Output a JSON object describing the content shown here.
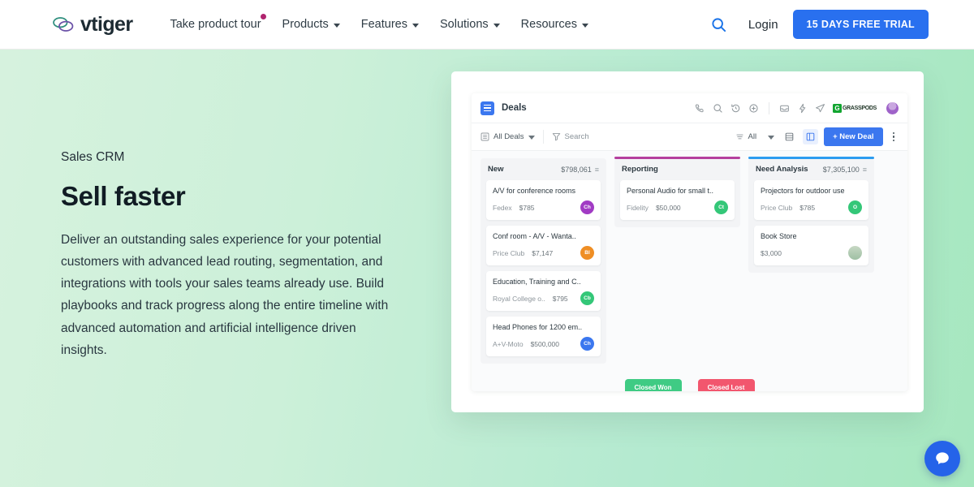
{
  "nav": {
    "logo_text": "vtiger",
    "logo_icon": "vtiger-cloud-logo",
    "links": [
      {
        "label": "Take product tour",
        "caret": false,
        "badge": true
      },
      {
        "label": "Products",
        "caret": true,
        "badge": false
      },
      {
        "label": "Features",
        "caret": true,
        "badge": false
      },
      {
        "label": "Solutions",
        "caret": true,
        "badge": false
      },
      {
        "label": "Resources",
        "caret": true,
        "badge": false
      }
    ],
    "search_icon": "search-icon",
    "login_label": "Login",
    "trial_label": "15 DAYS FREE TRIAL",
    "trial_color": "#2970ef"
  },
  "hero": {
    "eyebrow": "Sales CRM",
    "title": "Sell faster",
    "body": "Deliver an outstanding sales experience for your potential customers with advanced lead routing, segmentation, and integrations with tools your sales teams already use. Build playbooks and track progress along the entire timeline with advanced automation and artificial intelligence driven insights.",
    "bg_from": "#d6f2de",
    "bg_to": "#a6e7bf"
  },
  "app": {
    "topbar": {
      "menu_icon": "hamburger-square-icon",
      "title": "Deals",
      "icons": [
        "phone-icon",
        "search-icon",
        "history-icon",
        "plus-circle-icon",
        "inbox-icon",
        "lightning-icon",
        "paper-plane-icon"
      ],
      "brand_badge_letter": "G",
      "brand_badge_text": "GRASSPODS",
      "brand_badge_color": "#12a530",
      "avatar": "user-avatar"
    },
    "toolbar": {
      "view_label": "All Deals",
      "view_icon": "list-box-icon",
      "filter_icon": "funnel-icon",
      "search_placeholder": "Search",
      "sort_icon": "sort-lines-icon",
      "sort_label": "All",
      "list_view_icon": "list-view-icon",
      "board_view_icon": "kanban-view-icon",
      "new_deal_label": "+ New Deal",
      "new_deal_color": "#3b77ef",
      "more_icon": "kebab-menu-icon"
    },
    "columns": [
      {
        "name": "New",
        "total": "$798,061",
        "accent": "",
        "cards": [
          {
            "title": "A/V for conference rooms",
            "account": "Fedex",
            "amount": "$785",
            "avatar_text": "Ch",
            "avatar_color": "#a13bc4"
          },
          {
            "title": "Conf room - A/V - Wanta..",
            "account": "Price Club",
            "amount": "$7,147",
            "avatar_text": "Bl",
            "avatar_color": "#ef8e24"
          },
          {
            "title": "Education, Training and C..",
            "account": "Royal College o..",
            "amount": "$795",
            "avatar_text": "Cb",
            "avatar_color": "#34c778"
          },
          {
            "title": "Head Phones for 1200 em..",
            "account": "A+V-Moto",
            "amount": "$500,000",
            "avatar_text": "Ch",
            "avatar_color": "#3b77ef"
          }
        ]
      },
      {
        "name": "Reporting",
        "total": "",
        "accent": "#b5409e",
        "cards": [
          {
            "title": "Personal Audio for small t..",
            "account": "Fidelity",
            "amount": "$50,000",
            "avatar_text": "Ct",
            "avatar_color": "#34c778"
          }
        ]
      },
      {
        "name": "Need Analysis",
        "total": "$7,305,100",
        "accent": "#2d9cf0",
        "cards": [
          {
            "title": "Projectors for outdoor use",
            "account": "Price Club",
            "amount": "$785",
            "avatar_text": "O",
            "avatar_color": "#34c778"
          },
          {
            "title": "Book Store",
            "account": "",
            "amount": "$3,000",
            "avatar_text": "",
            "avatar_color": "#cfd9cc"
          }
        ]
      }
    ],
    "drop_targets": [
      {
        "label": "Closed Won",
        "color": "#3fcb84"
      },
      {
        "label": "Closed Lost",
        "color": "#f2566e"
      }
    ]
  },
  "chat": {
    "icon": "chat-bubble-icon",
    "color": "#2563e9"
  }
}
